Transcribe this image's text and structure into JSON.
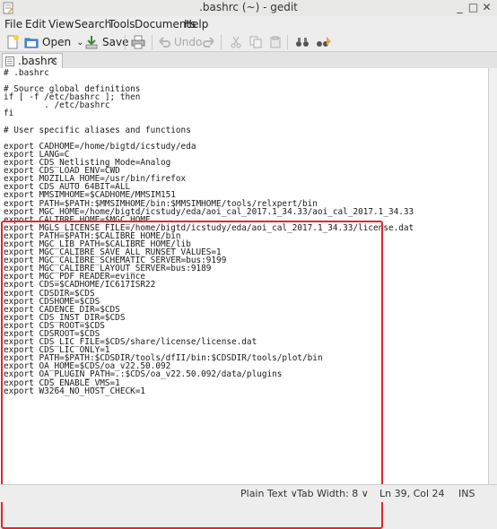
{
  "window": {
    "title": ".bashrc (~) - gedit",
    "min": "_",
    "max": "□",
    "close": "✕"
  },
  "menu": [
    "File",
    "Edit",
    "View",
    "Search",
    "Tools",
    "Documents",
    "Help"
  ],
  "toolbar": {
    "open_label": "Open",
    "save_label": "Save",
    "undo_label": "Undo"
  },
  "tab": {
    "label": ".bashrc",
    "close": "✕"
  },
  "editor": {
    "lines": [
      "# .bashrc",
      "",
      "# Source global definitions",
      "if [ -f /etc/bashrc ]; then",
      "        . /etc/bashrc",
      "fi",
      "",
      "# User specific aliases and functions",
      "",
      "export CADHOME=/home/bigtd/icstudy/eda",
      "export LANG=C",
      "export CDS_Netlisting_Mode=Analog",
      "export CDS_LOAD_ENV=CWD",
      "export MOZILLA_HOME=/usr/bin/firefox",
      "export CDS_AUTO_64BIT=ALL",
      "export MMSIMHOME=$CADHOME/MMSIM151",
      "export PATH=$PATH:$MMSIMHOME/bin:$MMSIMHOME/tools/relxpert/bin",
      "export MGC_HOME=/home/bigtd/icstudy/eda/aoi_cal_2017.1_34.33/aoi_cal_2017.1_34.33",
      "export CALIBRE_HOME=$MGC_HOME",
      "export MGLS_LICENSE_FILE=/home/bigtd/icstudy/eda/aoi_cal_2017.1_34.33/license.dat",
      "export PATH=$PATH:$CALIBRE_HOME/bin",
      "export MGC_LIB_PATH=$CALIBRE_HOME/lib",
      "export MGC_CALIBRE_SAVE_ALL_RUNSET_VALUES=1",
      "export MGC_CALIBRE_SCHEMATIC_SERVER=bus:9199",
      "export MGC_CALIBRE_LAYOUT_SERVER=bus:9189",
      "export MGC_PDF_READER=evince",
      "export CDS=$CADHOME/IC617ISR22",
      "export CDSDIR=$CDS",
      "export CDSHOME=$CDS",
      "export CADENCE_DIR=$CDS",
      "export CDS_INST_DIR=$CDS",
      "export CDS_ROOT=$CDS",
      "export CDSROOT=$CDS",
      "export CDS_LIC_FILE=$CDS/share/license/license.dat",
      "export CDS_LIC_ONLY=1",
      "export PATH=$PATH:$CDSDIR/tools/dfII/bin:$CDSDIR/tools/plot/bin",
      "export OA_HOME=$CDS/oa_v22.50.092",
      "export OA_PLUGIN_PATH=.:$CDS/oa_v22.50.092/data/plugins",
      "export CDS_ENABLE_VMS=1",
      "export W3264_NO_HOST_CHECK=1"
    ],
    "highlight_color": "#e0262b"
  },
  "status": {
    "language": "Plain Text ∨",
    "tab_width": "Tab Width: 8 ∨",
    "position": "Ln 39, Col 24",
    "mode": "INS"
  }
}
